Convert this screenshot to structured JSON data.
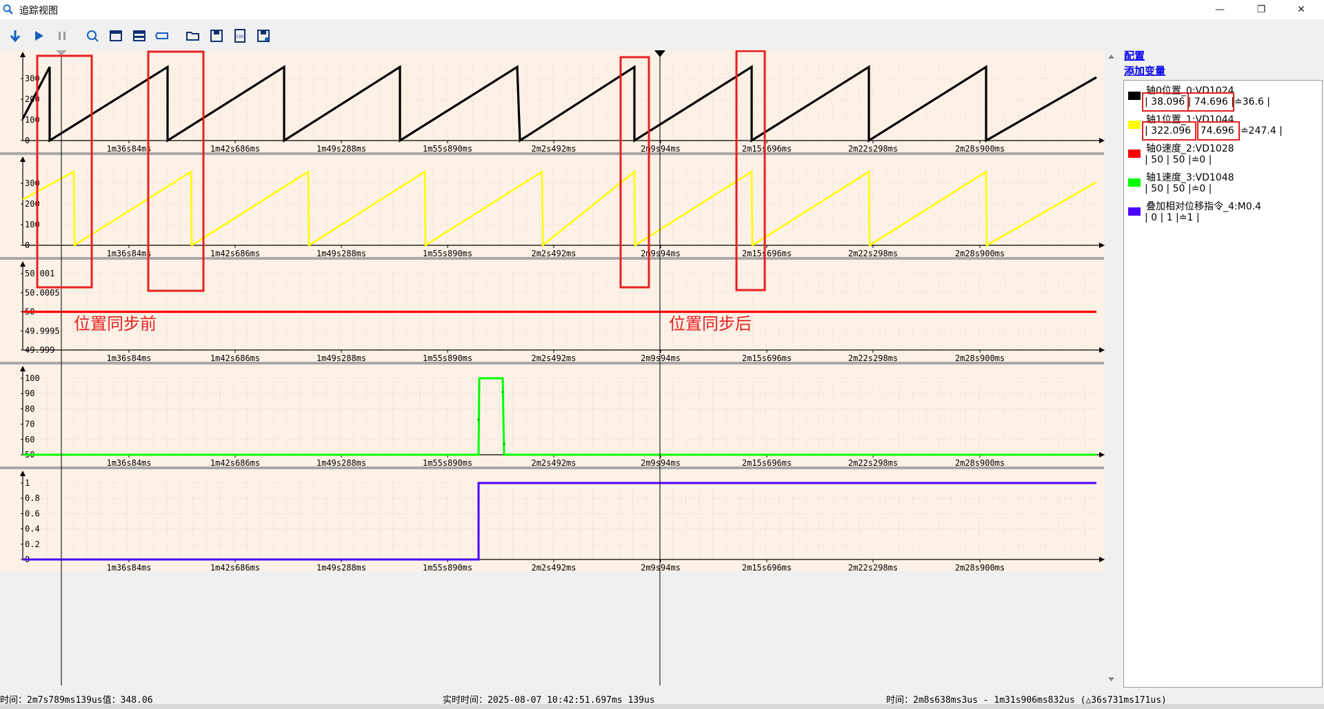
{
  "window": {
    "title": "追踪视图",
    "minimize": "—",
    "restore": "❐",
    "close": "✕"
  },
  "toolbar": {
    "icons": [
      "download-arrow-icon",
      "play-icon",
      "pause-icon",
      "trigger-icon",
      "window-icon",
      "split-window-icon",
      "label-icon",
      "open-folder-icon",
      "save-icon",
      "csv-export-icon",
      "save-as-icon"
    ]
  },
  "config": {
    "config_link": "配置",
    "add_var_link": "添加变量"
  },
  "legend": [
    {
      "name": "轴0位置_0:VD1024",
      "color": "#000000",
      "v1": "38.096",
      "v2": "74.696",
      "delta": "≐36.6"
    },
    {
      "name": "轴1位置_1:VD1044",
      "color": "#ffff00",
      "v1": "322.096",
      "v2": "74.696",
      "delta": "≐247.4"
    },
    {
      "name": "轴0速度_2:VD1028",
      "color": "#ff0000",
      "v1": "50",
      "v2": "50",
      "delta": "≐0"
    },
    {
      "name": "轴1速度_3:VD1048",
      "color": "#00ff00",
      "v1": "50",
      "v2": "50",
      "delta": "≐0"
    },
    {
      "name": "叠加相对位移指令_4:M0.4",
      "color": "#4b00ff",
      "v1": "0",
      "v2": "1",
      "delta": "≐1"
    }
  ],
  "annotations": {
    "before": "位置同步前",
    "after": "位置同步后"
  },
  "x_ticks": [
    "1m36s84ms",
    "1m42s686ms",
    "1m49s288ms",
    "1m55s890ms",
    "2m2s492ms",
    "2m9s94ms",
    "2m15s696ms",
    "2m22s298ms",
    "2m28s900ms"
  ],
  "status": {
    "cursor": "时间：2m7s789ms139us值：348.06",
    "realtime": "实时时间：2025-08-07 10:42:51.697ms 139us",
    "range": "时间：2m8s638ms3us - 1m31s906ms832us (△36s731ms171us)"
  },
  "chart_data": [
    {
      "type": "line",
      "series": [
        {
          "name": "轴0位置_0:VD1024",
          "color": "#000000"
        }
      ],
      "yticks": [
        "0",
        "100",
        "200",
        "300"
      ],
      "ylim": [
        0,
        370
      ],
      "x": [
        "1m36s84ms",
        "1m42s686ms",
        "1m49s288ms",
        "1m55s890ms",
        "2m2s492ms",
        "2m9s94ms",
        "2m15s696ms",
        "2m22s298ms",
        "2m28s900ms"
      ]
    },
    {
      "type": "line",
      "series": [
        {
          "name": "轴1位置_1:VD1044",
          "color": "#ffff00"
        }
      ],
      "yticks": [
        "0",
        "100",
        "200",
        "300"
      ],
      "ylim": [
        0,
        370
      ]
    },
    {
      "type": "line",
      "series": [
        {
          "name": "轴0速度_2:VD1028",
          "color": "#ff0000",
          "value": 50
        }
      ],
      "yticks": [
        "49.999",
        "49.9995",
        "50",
        "50.0005",
        "50.001"
      ],
      "ylim": [
        49.999,
        50.001
      ]
    },
    {
      "type": "line",
      "series": [
        {
          "name": "轴1速度_3:VD1048",
          "color": "#00ff00"
        }
      ],
      "yticks": [
        "50",
        "60",
        "70",
        "80",
        "90",
        "100"
      ],
      "ylim": [
        50,
        100
      ]
    },
    {
      "type": "line",
      "series": [
        {
          "name": "叠加相对位移指令_4:M0.4",
          "color": "#4b00ff"
        }
      ],
      "yticks": [
        "0",
        "0.2",
        "0.4",
        "0.6",
        "0.8",
        "1"
      ],
      "ylim": [
        0,
        1
      ]
    }
  ]
}
